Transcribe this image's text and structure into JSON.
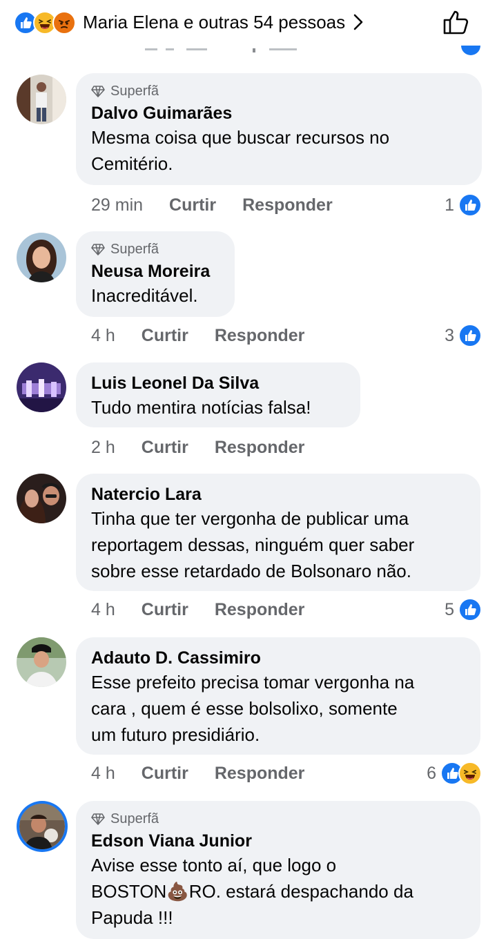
{
  "header": {
    "reactions": [
      "like-icon",
      "haha-icon",
      "angry-icon"
    ],
    "reactors_text": "Maria Elena e outras 54 pessoas"
  },
  "colors": {
    "brand_blue": "#1877f2",
    "bubble_bg": "#f0f2f5",
    "meta_gray": "#65676b"
  },
  "comments": [
    {
      "badge": "Superfã",
      "author": "Dalvo Guimarães",
      "text": "Mesma coisa que buscar recursos no\nCemitério.",
      "time": "29 min",
      "like_label": "Curtir",
      "reply_label": "Responder",
      "reaction_count": "1"
    },
    {
      "badge": "Superfã",
      "author": "Neusa Moreira",
      "text": "Inacreditável.",
      "time": "4 h",
      "like_label": "Curtir",
      "reply_label": "Responder",
      "reaction_count": "3"
    },
    {
      "author": "Luis Leonel Da Silva",
      "text": "Tudo mentira notícias falsa!",
      "time": "2 h",
      "like_label": "Curtir",
      "reply_label": "Responder"
    },
    {
      "author": "Natercio Lara",
      "text": "Tinha que ter vergonha de publicar uma\nreportagem dessas, ninguém quer saber\nsobre esse retardado de Bolsonaro não.",
      "time": "4 h",
      "like_label": "Curtir",
      "reply_label": "Responder",
      "reaction_count": "5"
    },
    {
      "author": "Adauto D. Cassimiro",
      "text": "Esse prefeito precisa tomar vergonha na\ncara , quem é esse bolsolixo, somente\num futuro presidiário.",
      "time": "4 h",
      "like_label": "Curtir",
      "reply_label": "Responder",
      "reaction_count": "6"
    },
    {
      "badge": "Superfã",
      "author": "Edson Viana Junior",
      "text": "Avise esse tonto aí, que logo o\nBOSTON💩RO. estará despachando da\nPapuda !!!"
    }
  ]
}
